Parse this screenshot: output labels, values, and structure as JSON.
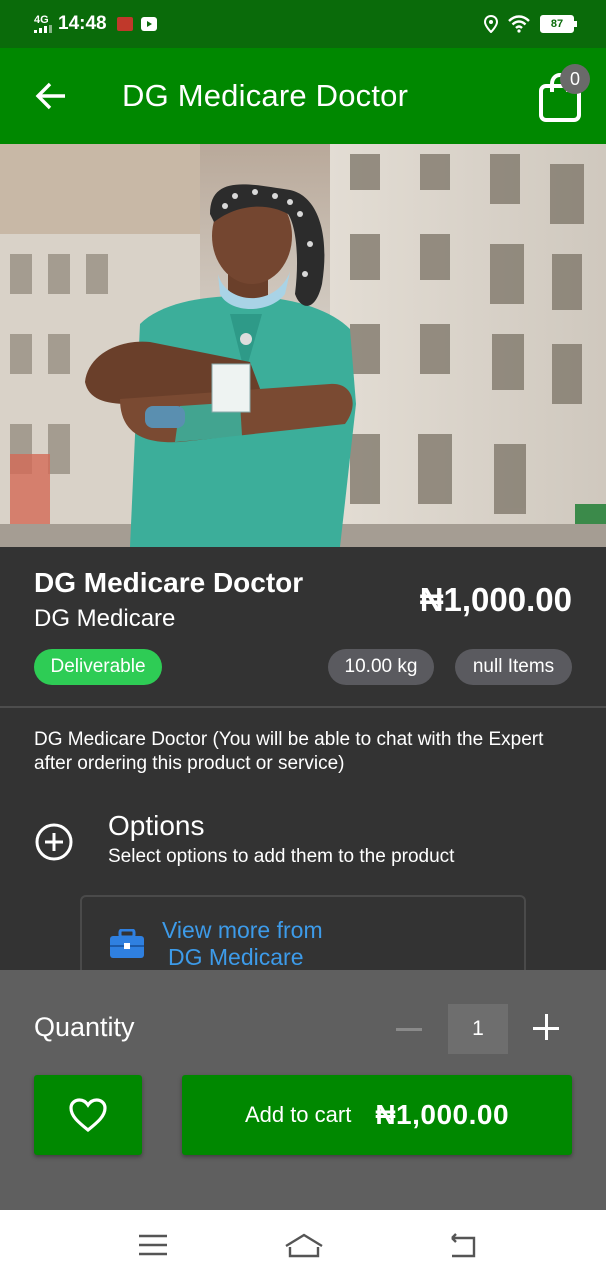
{
  "status_bar": {
    "network": "4G",
    "time": "14:48",
    "battery": "87",
    "icons": [
      "signal-icon",
      "notification-icon",
      "youtube-icon",
      "location-icon",
      "wifi-icon",
      "battery-icon"
    ]
  },
  "app_bar": {
    "title": "DG Medicare Doctor",
    "cart_count": "0",
    "icons": [
      "back-arrow-icon",
      "shopping-bag-icon"
    ]
  },
  "product": {
    "name": "DG Medicare Doctor",
    "vendor": "DG Medicare",
    "price": "₦1,000.00",
    "badge": "Deliverable",
    "weight": "10.00 kg",
    "items": "null Items",
    "description": "DG Medicare Doctor (You will be able to chat with the Expert after ordering this product or service)"
  },
  "options": {
    "title": "Options",
    "subtitle": "Select options to add them to the product",
    "icon": "plus-circle-icon"
  },
  "view_more": {
    "line1": "View more from",
    "line2": "DG Medicare",
    "icon": "briefcase-icon"
  },
  "bottom": {
    "quantity_label": "Quantity",
    "quantity_value": "1",
    "add_to_cart_label": "Add to cart",
    "add_to_cart_price": "₦1,000.00",
    "icons": [
      "minus-icon",
      "plus-icon",
      "heart-icon"
    ]
  },
  "colors": {
    "status_bar": "#0a6b0a",
    "app_bar": "#008800",
    "background": "#333333",
    "badge_green": "#2ecc55",
    "chip_grey": "#5a5a5f",
    "link_blue": "#3d9be9",
    "panel": "#5f5f5f"
  }
}
